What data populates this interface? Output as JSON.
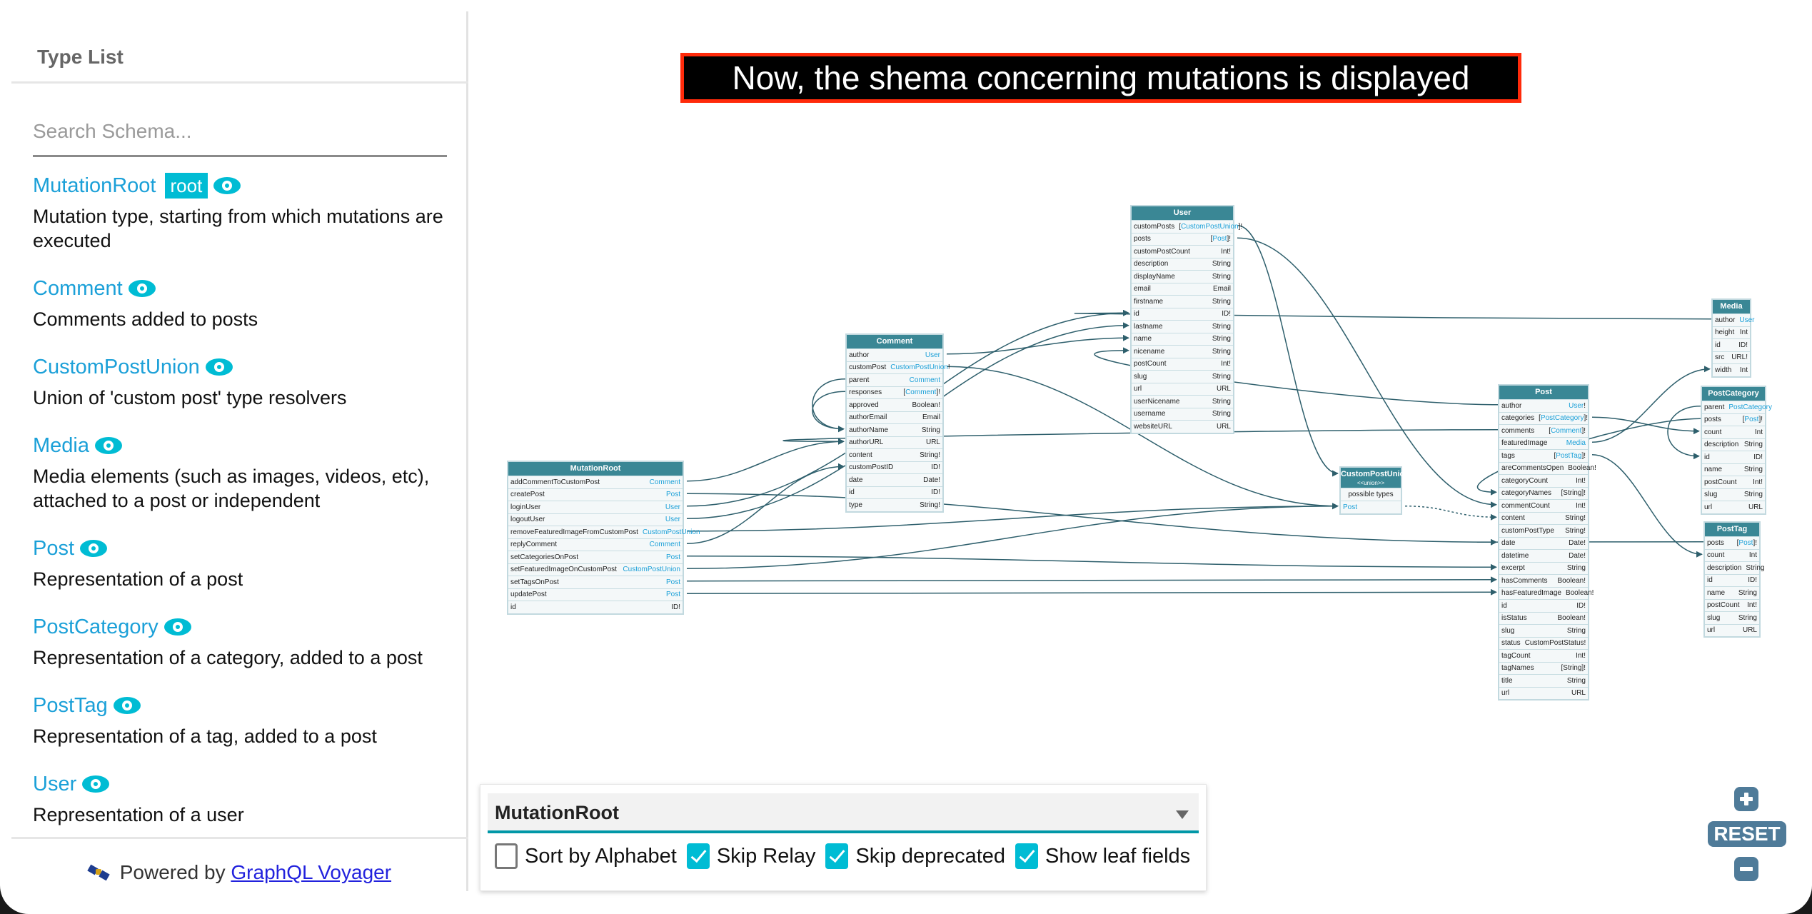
{
  "sidebar": {
    "title": "Type List",
    "search_placeholder": "Search Schema...",
    "search_value": "",
    "types": [
      {
        "name": "MutationRoot",
        "badge": "root",
        "description": "Mutation type, starting from which mutations are executed"
      },
      {
        "name": "Comment",
        "description": "Comments added to posts"
      },
      {
        "name": "CustomPostUnion",
        "description": "Union of 'custom post' type resolvers"
      },
      {
        "name": "Media",
        "description": "Media elements (such as images, videos, etc), attached to a post or independent"
      },
      {
        "name": "Post",
        "description": "Representation of a post"
      },
      {
        "name": "PostCategory",
        "description": "Representation of a category, added to a post"
      },
      {
        "name": "PostTag",
        "description": "Representation of a tag, added to a post"
      },
      {
        "name": "User",
        "description": "Representation of a user"
      }
    ],
    "footer": {
      "prefix": "Powered by",
      "link_text": "GraphQL Voyager"
    }
  },
  "banner": {
    "text": "Now, the shema concerning mutations is displayed"
  },
  "colors": {
    "accent": "#00bcd4",
    "link": "#1ba0d8",
    "node_header": "#3a8795",
    "edge": "#2e5f6c",
    "zoom_button": "#4f7b99",
    "banner_border": "#ff2a0a"
  },
  "graph": {
    "nodes": [
      {
        "id": "MutationRoot",
        "title": "MutationRoot",
        "fields": [
          {
            "name": "addCommentToCustomPost",
            "type": "Comment",
            "link": true
          },
          {
            "name": "createPost",
            "type": "Post",
            "link": true
          },
          {
            "name": "loginUser",
            "type": "User",
            "link": true
          },
          {
            "name": "logoutUser",
            "type": "User",
            "link": true
          },
          {
            "name": "removeFeaturedImageFromCustomPost",
            "type": "CustomPostUnion",
            "link": true
          },
          {
            "name": "replyComment",
            "type": "Comment",
            "link": true
          },
          {
            "name": "setCategoriesOnPost",
            "type": "Post",
            "link": true
          },
          {
            "name": "setFeaturedImageOnCustomPost",
            "type": "CustomPostUnion",
            "link": true
          },
          {
            "name": "setTagsOnPost",
            "type": "Post",
            "link": true
          },
          {
            "name": "updatePost",
            "type": "Post",
            "link": true
          },
          {
            "name": "id",
            "type": "ID!",
            "link": false
          }
        ]
      },
      {
        "id": "Comment",
        "title": "Comment",
        "fields": [
          {
            "name": "author",
            "type": "User",
            "link": true
          },
          {
            "name": "customPost",
            "type": "CustomPostUnion",
            "suffix": "!",
            "link": true
          },
          {
            "name": "parent",
            "type": "Comment",
            "link": true
          },
          {
            "name": "responses",
            "type": "Comment",
            "prefix": "[",
            "suffix": "]!",
            "link": true
          },
          {
            "name": "approved",
            "type": "Boolean!",
            "link": false
          },
          {
            "name": "authorEmail",
            "type": "Email",
            "link": false
          },
          {
            "name": "authorName",
            "type": "String",
            "link": false
          },
          {
            "name": "authorURL",
            "type": "URL",
            "link": false
          },
          {
            "name": "content",
            "type": "String!",
            "link": false
          },
          {
            "name": "customPostID",
            "type": "ID!",
            "link": false
          },
          {
            "name": "date",
            "type": "Date!",
            "link": false
          },
          {
            "name": "id",
            "type": "ID!",
            "link": false
          },
          {
            "name": "type",
            "type": "String!",
            "link": false
          }
        ]
      },
      {
        "id": "User",
        "title": "User",
        "fields": [
          {
            "name": "customPosts",
            "type": "CustomPostUnion",
            "prefix": "[",
            "suffix": "]!",
            "link": true
          },
          {
            "name": "posts",
            "type": "Post",
            "prefix": "[",
            "suffix": "]!",
            "link": true
          },
          {
            "name": "customPostCount",
            "type": "Int!",
            "link": false
          },
          {
            "name": "description",
            "type": "String",
            "link": false
          },
          {
            "name": "displayName",
            "type": "String",
            "link": false
          },
          {
            "name": "email",
            "type": "Email",
            "link": false
          },
          {
            "name": "firstname",
            "type": "String",
            "link": false
          },
          {
            "name": "id",
            "type": "ID!",
            "link": false
          },
          {
            "name": "lastname",
            "type": "String",
            "link": false
          },
          {
            "name": "name",
            "type": "String",
            "link": false
          },
          {
            "name": "nicename",
            "type": "String",
            "link": false
          },
          {
            "name": "postCount",
            "type": "Int!",
            "link": false
          },
          {
            "name": "slug",
            "type": "String",
            "link": false
          },
          {
            "name": "url",
            "type": "URL",
            "link": false
          },
          {
            "name": "userNicename",
            "type": "String",
            "link": false
          },
          {
            "name": "username",
            "type": "String",
            "link": false
          },
          {
            "name": "websiteURL",
            "type": "URL",
            "link": false
          }
        ]
      },
      {
        "id": "CustomPostUnion",
        "title": "CustomPostUnion",
        "subtitle": "<<union>>",
        "possible_label": "possible types",
        "fields": [
          {
            "name": "Post",
            "type": "",
            "link": true,
            "name_link": true
          }
        ]
      },
      {
        "id": "Post",
        "title": "Post",
        "fields": [
          {
            "name": "author",
            "type": "User",
            "suffix": "!",
            "link": true
          },
          {
            "name": "categories",
            "type": "PostCategory",
            "prefix": "[",
            "suffix": "]!",
            "link": true
          },
          {
            "name": "comments",
            "type": "Comment",
            "prefix": "[",
            "suffix": "]!",
            "link": true
          },
          {
            "name": "featuredImage",
            "type": "Media",
            "link": true
          },
          {
            "name": "tags",
            "type": "PostTag",
            "prefix": "[",
            "suffix": "]!",
            "link": true
          },
          {
            "name": "areCommentsOpen",
            "type": "Boolean!",
            "link": false
          },
          {
            "name": "categoryCount",
            "type": "Int!",
            "link": false
          },
          {
            "name": "categoryNames",
            "type": "[String]!",
            "link": false
          },
          {
            "name": "commentCount",
            "type": "Int!",
            "link": false
          },
          {
            "name": "content",
            "type": "String!",
            "link": false
          },
          {
            "name": "customPostType",
            "type": "String!",
            "link": false
          },
          {
            "name": "date",
            "type": "Date!",
            "link": false
          },
          {
            "name": "datetime",
            "type": "Date!",
            "link": false
          },
          {
            "name": "excerpt",
            "type": "String",
            "link": false
          },
          {
            "name": "hasComments",
            "type": "Boolean!",
            "link": false
          },
          {
            "name": "hasFeaturedImage",
            "type": "Boolean!",
            "link": false
          },
          {
            "name": "id",
            "type": "ID!",
            "link": false
          },
          {
            "name": "isStatus",
            "type": "Boolean!",
            "link": false
          },
          {
            "name": "slug",
            "type": "String",
            "link": false
          },
          {
            "name": "status",
            "type": "CustomPostStatus!",
            "link": false
          },
          {
            "name": "tagCount",
            "type": "Int!",
            "link": false
          },
          {
            "name": "tagNames",
            "type": "[String]!",
            "link": false
          },
          {
            "name": "title",
            "type": "String",
            "link": false
          },
          {
            "name": "url",
            "type": "URL",
            "link": false
          }
        ]
      },
      {
        "id": "Media",
        "title": "Media",
        "fields": [
          {
            "name": "author",
            "type": "User",
            "link": true
          },
          {
            "name": "height",
            "type": "Int",
            "link": false
          },
          {
            "name": "id",
            "type": "ID!",
            "link": false
          },
          {
            "name": "src",
            "type": "URL!",
            "link": false
          },
          {
            "name": "width",
            "type": "Int",
            "link": false
          }
        ]
      },
      {
        "id": "PostCategory",
        "title": "PostCategory",
        "fields": [
          {
            "name": "parent",
            "type": "PostCategory",
            "link": true
          },
          {
            "name": "posts",
            "type": "Post",
            "prefix": "[",
            "suffix": "]!",
            "link": true
          },
          {
            "name": "count",
            "type": "Int",
            "link": false
          },
          {
            "name": "description",
            "type": "String",
            "link": false
          },
          {
            "name": "id",
            "type": "ID!",
            "link": false
          },
          {
            "name": "name",
            "type": "String",
            "link": false
          },
          {
            "name": "postCount",
            "type": "Int!",
            "link": false
          },
          {
            "name": "slug",
            "type": "String",
            "link": false
          },
          {
            "name": "url",
            "type": "URL",
            "link": false
          }
        ]
      },
      {
        "id": "PostTag",
        "title": "PostTag",
        "fields": [
          {
            "name": "posts",
            "type": "Post",
            "prefix": "[",
            "suffix": "]!",
            "link": true
          },
          {
            "name": "count",
            "type": "Int",
            "link": false
          },
          {
            "name": "description",
            "type": "String",
            "link": false
          },
          {
            "name": "id",
            "type": "ID!",
            "link": false
          },
          {
            "name": "name",
            "type": "String",
            "link": false
          },
          {
            "name": "postCount",
            "type": "Int!",
            "link": false
          },
          {
            "name": "slug",
            "type": "String",
            "link": false
          },
          {
            "name": "url",
            "type": "URL",
            "link": false
          }
        ]
      }
    ]
  },
  "panel": {
    "selected_root": "MutationRoot",
    "options": [
      {
        "label": "Sort by Alphabet",
        "checked": false
      },
      {
        "label": "Skip Relay",
        "checked": true
      },
      {
        "label": "Skip deprecated",
        "checked": true
      },
      {
        "label": "Show leaf fields",
        "checked": true
      }
    ]
  },
  "zoom_controls": {
    "zoom_in": "+",
    "reset": "RESET",
    "zoom_out": "−"
  }
}
